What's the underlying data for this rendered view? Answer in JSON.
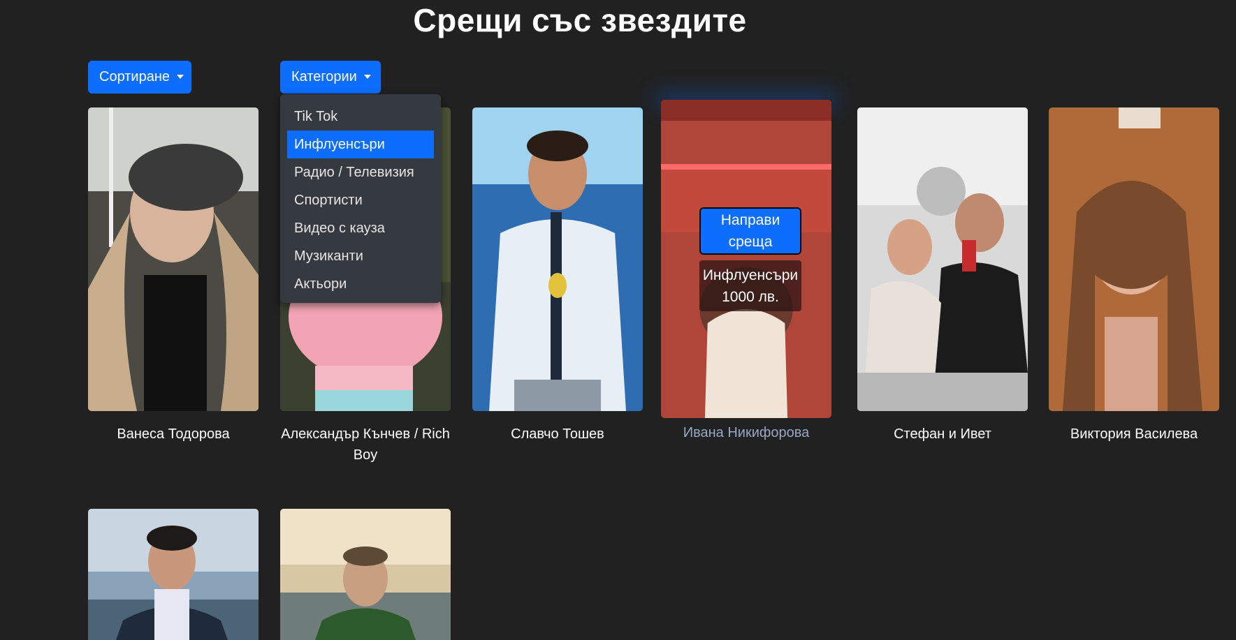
{
  "header": {
    "title": "Срещи със звездите"
  },
  "controls": {
    "sort_label": "Сортиране",
    "categories_label": "Категории"
  },
  "dropdown": {
    "items": [
      {
        "label": "Tik Tok",
        "active": false
      },
      {
        "label": "Инфлуенсъри",
        "active": true
      },
      {
        "label": "Радио / Телевизия",
        "active": false
      },
      {
        "label": "Спортисти",
        "active": false
      },
      {
        "label": "Видео с кауза",
        "active": false
      },
      {
        "label": "Музиканти",
        "active": false
      },
      {
        "label": "Актьори",
        "active": false
      }
    ]
  },
  "cards": [
    {
      "name": "Ванеса Тодорова"
    },
    {
      "name": "Александър Кънчев / Rich Boy"
    },
    {
      "name": "Славчо Тошев"
    },
    {
      "name": "Ивана Никифорова",
      "hovered": true,
      "action_label": "Направи среща",
      "category": "Инфлуенсъри",
      "price": "1000 лв."
    },
    {
      "name": "Стефан и Ивет"
    },
    {
      "name": "Виктория Василева"
    },
    {
      "name": ""
    },
    {
      "name": ""
    }
  ],
  "colors": {
    "background": "#212121",
    "primary": "#0d6efd",
    "dropdown_bg": "#343a40"
  }
}
